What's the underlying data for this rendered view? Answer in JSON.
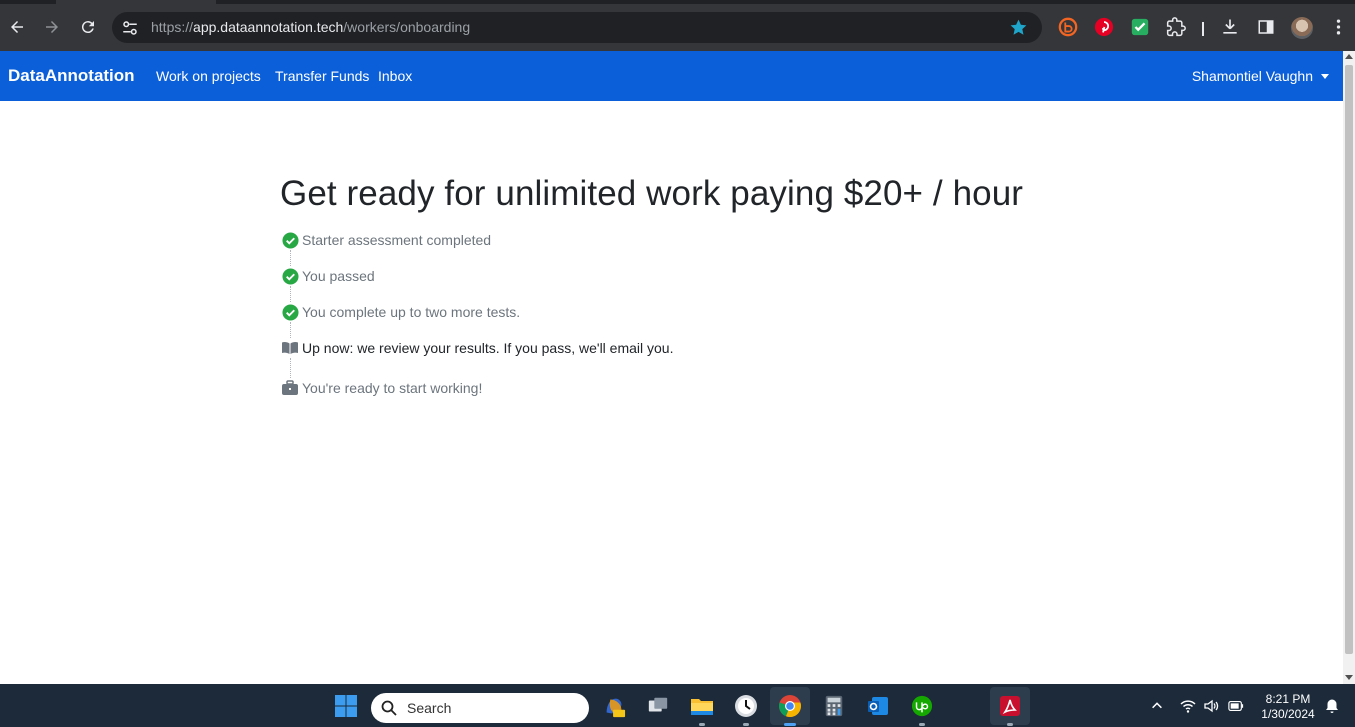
{
  "browser": {
    "url_scheme": "https://",
    "url_host": "app.dataannotation.tech",
    "url_path": "/workers/onboarding",
    "icons": [
      "back-icon",
      "forward-icon",
      "reload-icon",
      "site-info-icon",
      "bookmark-star-icon",
      "extension-icon",
      "puzzle-icon",
      "download-icon",
      "side-panel-icon",
      "profile-avatar",
      "more-menu-icon"
    ]
  },
  "navbar": {
    "brand": "DataAnnotation",
    "links": [
      "Work on projects",
      "Transfer Funds",
      "Inbox"
    ],
    "user_name": "Shamontiel Vaughn",
    "color": "#0b5fd8"
  },
  "main": {
    "headline": "Get ready for unlimited work paying $20+ / hour",
    "steps": [
      {
        "text": "Starter assessment completed",
        "status": "done",
        "icon": "check-circle-icon"
      },
      {
        "text": "You passed",
        "status": "done",
        "icon": "check-circle-icon"
      },
      {
        "text": "You complete up to two more tests.",
        "status": "done",
        "icon": "check-circle-icon"
      },
      {
        "text": "Up now: we review your results. If you pass, we'll email you.",
        "status": "current",
        "icon": "book-icon"
      },
      {
        "text": "You're ready to start working!",
        "status": "pending",
        "icon": "briefcase-icon"
      }
    ],
    "done_color": "#28a745"
  },
  "taskbar": {
    "search_placeholder": "Search",
    "time": "8:21 PM",
    "date": "1/30/2024",
    "apps": [
      "windows-start-icon",
      "copilot-icon",
      "task-view-icon",
      "file-explorer-icon",
      "clock-app-icon",
      "chrome-icon",
      "calculator-icon",
      "outlook-icon",
      "upwork-icon",
      "acrobat-icon"
    ]
  }
}
